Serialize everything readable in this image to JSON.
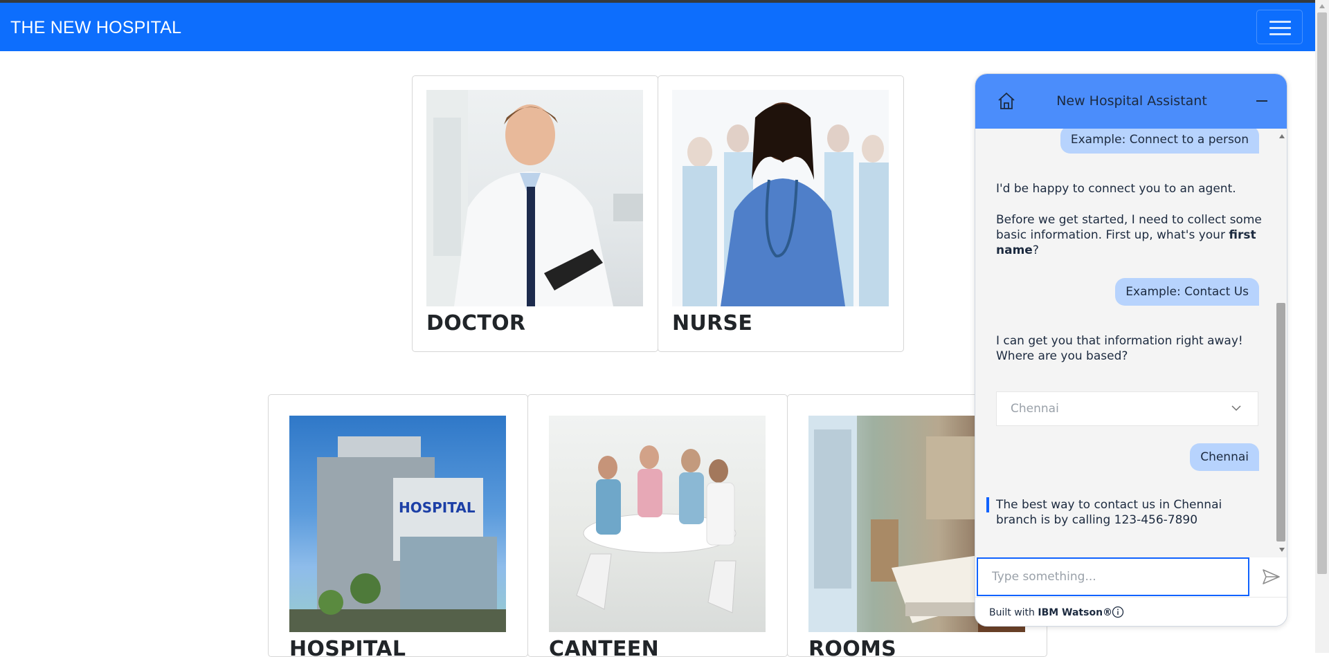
{
  "navbar": {
    "brand": "THE NEW HOSPITAL",
    "accent": "#0d6efd"
  },
  "cards": {
    "doctor": {
      "title": "DOCTOR"
    },
    "nurse": {
      "title": "NURSE"
    },
    "hospital": {
      "title": "HOSPITAL"
    },
    "canteen": {
      "title": "CANTEEN"
    },
    "rooms": {
      "title": "ROOMS"
    }
  },
  "chat": {
    "title": "New Hospital Assistant",
    "header_color": "#4b8dfb",
    "messages": {
      "user1": "Example: Connect to a person",
      "bot1_line1": "I'd be happy to connect you to an agent.",
      "bot1_line2_pre": "Before we get started, I need to collect some basic information. First up, what's your ",
      "bot1_line2_bold": "first name",
      "bot1_line2_post": "?",
      "user2": "Example: Contact Us",
      "bot2": "I can get you that information right away! Where are you based?",
      "dropdown_value": "Chennai",
      "user3": "Chennai",
      "bot3": "The best way to contact us in Chennai branch is by calling 123-456-7890"
    },
    "input_placeholder": "Type something...",
    "footer_pre": "Built with ",
    "footer_bold": "IBM Watson®"
  }
}
